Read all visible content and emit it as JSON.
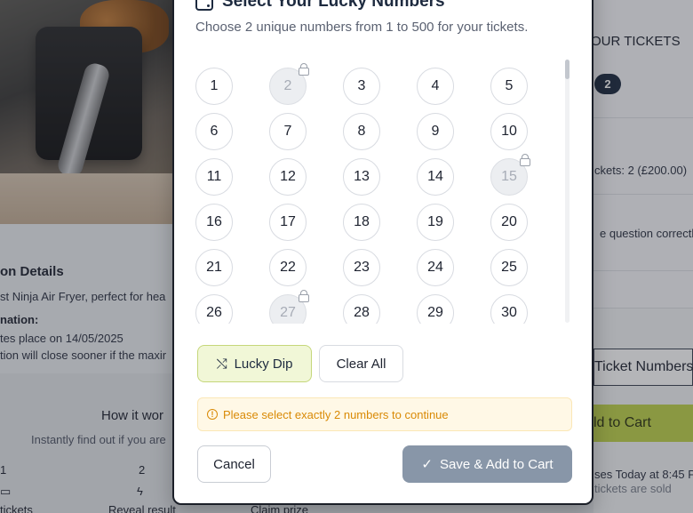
{
  "background": {
    "section_title": "on Details",
    "description": "st Ninja Air Fryer, perfect for hea",
    "info_heading": "nation:",
    "draw_date_text": "tes place on 14/05/2025",
    "close_note": "tion will close sooner if the maxir",
    "how_title": "How it wor",
    "how_sub": "Instantly find out if you are",
    "steps": [
      {
        "num": "1",
        "icon": "ticket-icon",
        "label": "tickets"
      },
      {
        "num": "2",
        "icon": "bolt-icon",
        "label": "Reveal result"
      },
      {
        "num": "",
        "icon": "",
        "label": "Claim prize"
      }
    ],
    "right_title": "OUR TICKETS",
    "right_badge": "2",
    "right_tickets_text": "ckets: 2 (£200.00)",
    "right_question_text": "e question correctly",
    "right_ticket_numbers_label": "Ticket Numbers",
    "right_cart_label": "ld to Cart",
    "right_closes_text": "ses Today at 8:45 P",
    "right_sold_text": "tickets are sold"
  },
  "modal": {
    "title": "Select Your Lucky Numbers",
    "subtitle": "Choose 2 unique numbers from 1 to 500 for your tickets.",
    "numbers": [
      {
        "n": "1",
        "locked": false
      },
      {
        "n": "2",
        "locked": true
      },
      {
        "n": "3",
        "locked": false
      },
      {
        "n": "4",
        "locked": false
      },
      {
        "n": "5",
        "locked": false
      },
      {
        "n": "6",
        "locked": false
      },
      {
        "n": "7",
        "locked": false
      },
      {
        "n": "8",
        "locked": false
      },
      {
        "n": "9",
        "locked": false
      },
      {
        "n": "10",
        "locked": false
      },
      {
        "n": "11",
        "locked": false
      },
      {
        "n": "12",
        "locked": false
      },
      {
        "n": "13",
        "locked": false
      },
      {
        "n": "14",
        "locked": false
      },
      {
        "n": "15",
        "locked": true
      },
      {
        "n": "16",
        "locked": false
      },
      {
        "n": "17",
        "locked": false
      },
      {
        "n": "18",
        "locked": false
      },
      {
        "n": "19",
        "locked": false
      },
      {
        "n": "20",
        "locked": false
      },
      {
        "n": "21",
        "locked": false
      },
      {
        "n": "22",
        "locked": false
      },
      {
        "n": "23",
        "locked": false
      },
      {
        "n": "24",
        "locked": false
      },
      {
        "n": "25",
        "locked": false
      },
      {
        "n": "26",
        "locked": false
      },
      {
        "n": "27",
        "locked": true
      },
      {
        "n": "28",
        "locked": false
      },
      {
        "n": "29",
        "locked": false
      },
      {
        "n": "30",
        "locked": false
      }
    ],
    "lucky_dip_label": "Lucky Dip",
    "clear_all_label": "Clear All",
    "alert_text": "Please select exactly 2 numbers to continue",
    "cancel_label": "Cancel",
    "save_label": "Save & Add to Cart"
  },
  "colors": {
    "accent_lime": "#bfd34a",
    "save_disabled": "#8896a8",
    "warning": "#d98a06",
    "navy": "#1d2a3f"
  }
}
